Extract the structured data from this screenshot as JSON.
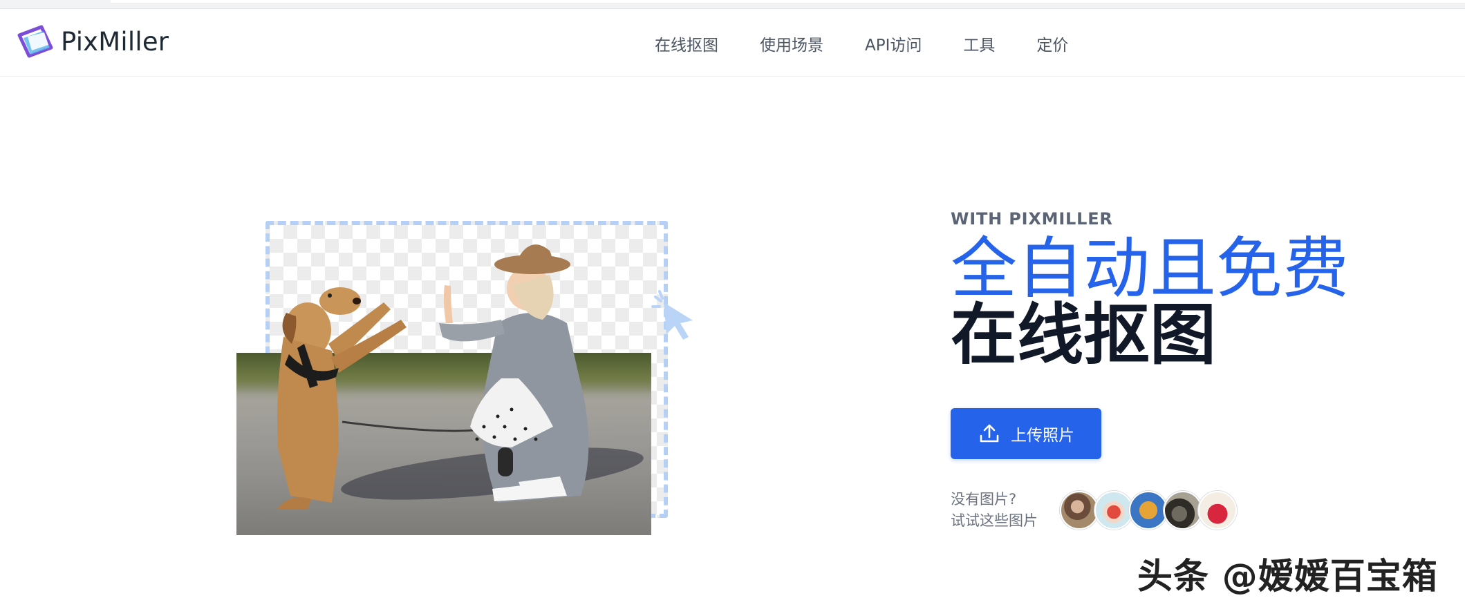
{
  "brand": {
    "name": "PixMiller",
    "logo_icon": "pixmiller-logo-icon",
    "accent": "#2563eb"
  },
  "nav": {
    "items": [
      {
        "label": "在线抠图"
      },
      {
        "label": "使用场景"
      },
      {
        "label": "API访问"
      },
      {
        "label": "工具"
      },
      {
        "label": "定价"
      }
    ]
  },
  "hero": {
    "eyebrow": "WITH PIXMILLER",
    "headline_line1": "全自动且免费",
    "headline_line2": "在线抠图",
    "upload_button": {
      "label": "上传照片",
      "icon": "upload-icon"
    },
    "sample": {
      "line1": "没有图片?",
      "line2": "试试这些图片",
      "thumbnails": [
        {
          "name": "sample-woman-photo"
        },
        {
          "name": "sample-drink-photo"
        },
        {
          "name": "sample-fries-photo"
        },
        {
          "name": "sample-restaurant-photo"
        },
        {
          "name": "sample-red-bag-photo"
        }
      ]
    }
  },
  "watermark": "头条 @嫒嫒百宝箱"
}
